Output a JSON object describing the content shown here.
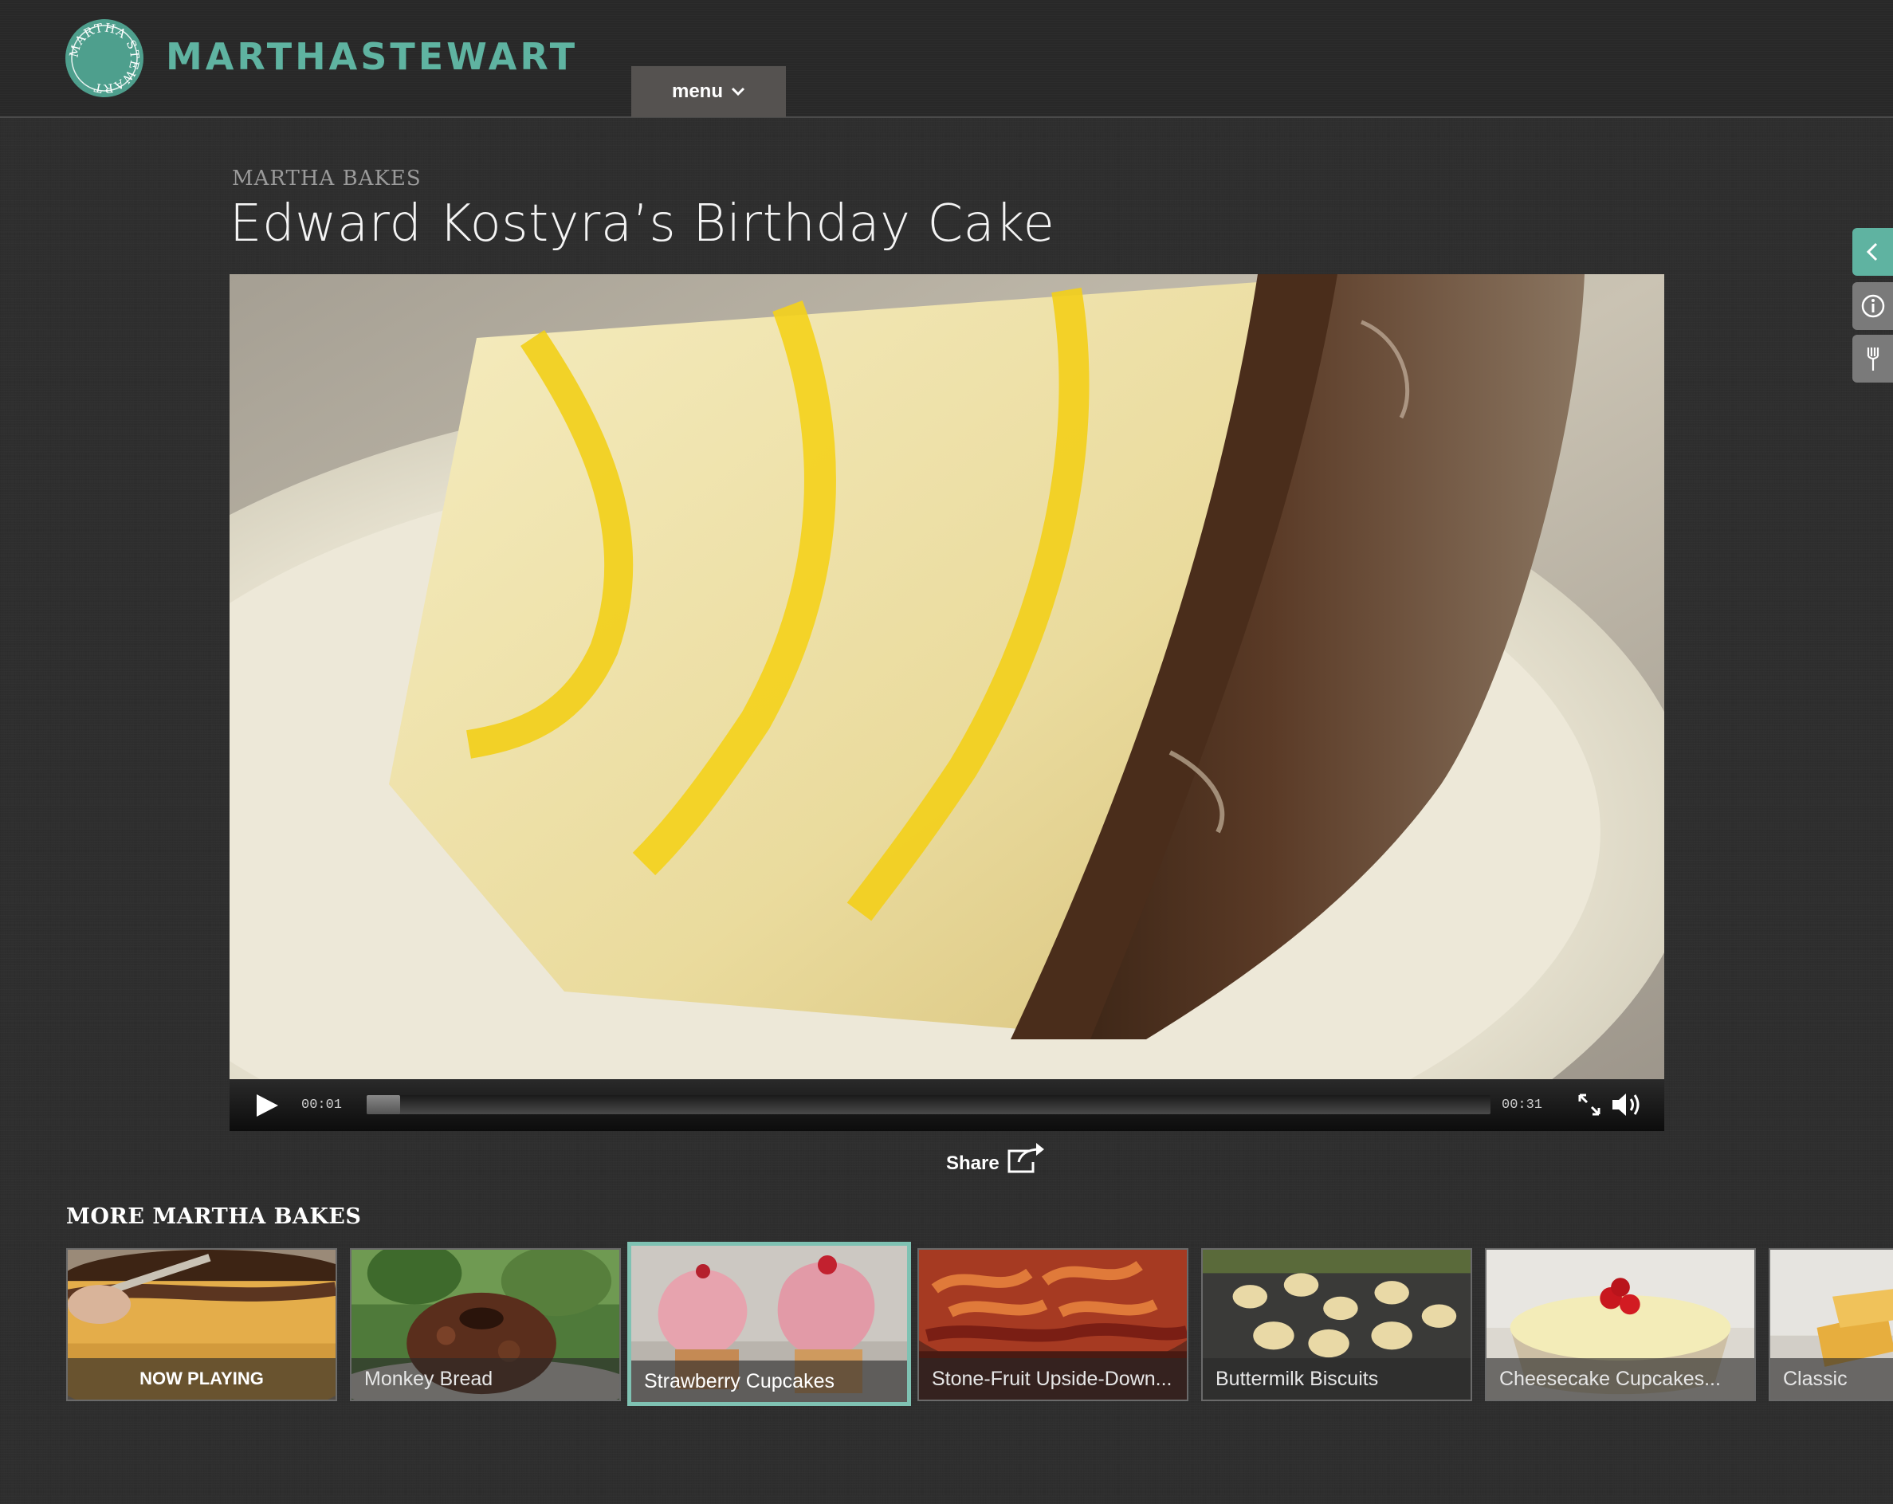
{
  "header": {
    "logo_seal_text": "MARTHA STEWART",
    "brand": "MARTHASTEWART",
    "menu_label": "menu"
  },
  "page": {
    "kicker": "MARTHA BAKES",
    "title": "Edward Kostyra’s Birthday Cake"
  },
  "side_tabs": [
    {
      "icon": "chevron-left-icon"
    },
    {
      "icon": "info-icon"
    },
    {
      "icon": "fork-icon"
    }
  ],
  "player": {
    "current_time": "00:01",
    "duration": "00:31",
    "progress_fraction": 0.03
  },
  "share": {
    "label": "Share"
  },
  "more": {
    "title": "MORE MARTHA BAKES",
    "items": [
      {
        "label": "NOW PLAYING",
        "state": "now-playing"
      },
      {
        "label": "Monkey Bread"
      },
      {
        "label": "Strawberry Cupcakes",
        "state": "selected"
      },
      {
        "label": "Stone-Fruit Upside-Down..."
      },
      {
        "label": "Buttermilk Biscuits"
      },
      {
        "label": "Cheesecake Cupcakes..."
      },
      {
        "label": "Classic"
      }
    ]
  },
  "colors": {
    "accent": "#5fb3a1",
    "background": "#2e2e2e",
    "selected_border": "#7fc2b3"
  }
}
